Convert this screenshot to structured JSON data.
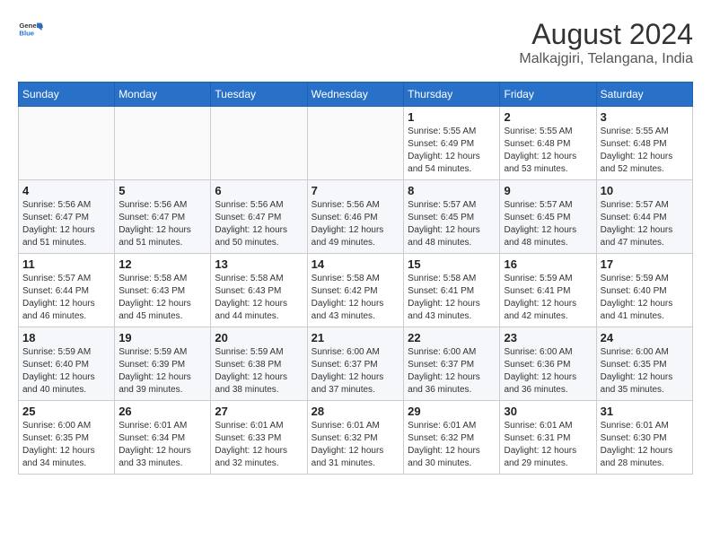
{
  "header": {
    "logo_general": "General",
    "logo_blue": "Blue",
    "title": "August 2024",
    "subtitle": "Malkajgiri, Telangana, India"
  },
  "weekdays": [
    "Sunday",
    "Monday",
    "Tuesday",
    "Wednesday",
    "Thursday",
    "Friday",
    "Saturday"
  ],
  "weeks": [
    [
      {
        "day": "",
        "info": ""
      },
      {
        "day": "",
        "info": ""
      },
      {
        "day": "",
        "info": ""
      },
      {
        "day": "",
        "info": ""
      },
      {
        "day": "1",
        "info": "Sunrise: 5:55 AM\nSunset: 6:49 PM\nDaylight: 12 hours\nand 54 minutes."
      },
      {
        "day": "2",
        "info": "Sunrise: 5:55 AM\nSunset: 6:48 PM\nDaylight: 12 hours\nand 53 minutes."
      },
      {
        "day": "3",
        "info": "Sunrise: 5:55 AM\nSunset: 6:48 PM\nDaylight: 12 hours\nand 52 minutes."
      }
    ],
    [
      {
        "day": "4",
        "info": "Sunrise: 5:56 AM\nSunset: 6:47 PM\nDaylight: 12 hours\nand 51 minutes."
      },
      {
        "day": "5",
        "info": "Sunrise: 5:56 AM\nSunset: 6:47 PM\nDaylight: 12 hours\nand 51 minutes."
      },
      {
        "day": "6",
        "info": "Sunrise: 5:56 AM\nSunset: 6:47 PM\nDaylight: 12 hours\nand 50 minutes."
      },
      {
        "day": "7",
        "info": "Sunrise: 5:56 AM\nSunset: 6:46 PM\nDaylight: 12 hours\nand 49 minutes."
      },
      {
        "day": "8",
        "info": "Sunrise: 5:57 AM\nSunset: 6:45 PM\nDaylight: 12 hours\nand 48 minutes."
      },
      {
        "day": "9",
        "info": "Sunrise: 5:57 AM\nSunset: 6:45 PM\nDaylight: 12 hours\nand 48 minutes."
      },
      {
        "day": "10",
        "info": "Sunrise: 5:57 AM\nSunset: 6:44 PM\nDaylight: 12 hours\nand 47 minutes."
      }
    ],
    [
      {
        "day": "11",
        "info": "Sunrise: 5:57 AM\nSunset: 6:44 PM\nDaylight: 12 hours\nand 46 minutes."
      },
      {
        "day": "12",
        "info": "Sunrise: 5:58 AM\nSunset: 6:43 PM\nDaylight: 12 hours\nand 45 minutes."
      },
      {
        "day": "13",
        "info": "Sunrise: 5:58 AM\nSunset: 6:43 PM\nDaylight: 12 hours\nand 44 minutes."
      },
      {
        "day": "14",
        "info": "Sunrise: 5:58 AM\nSunset: 6:42 PM\nDaylight: 12 hours\nand 43 minutes."
      },
      {
        "day": "15",
        "info": "Sunrise: 5:58 AM\nSunset: 6:41 PM\nDaylight: 12 hours\nand 43 minutes."
      },
      {
        "day": "16",
        "info": "Sunrise: 5:59 AM\nSunset: 6:41 PM\nDaylight: 12 hours\nand 42 minutes."
      },
      {
        "day": "17",
        "info": "Sunrise: 5:59 AM\nSunset: 6:40 PM\nDaylight: 12 hours\nand 41 minutes."
      }
    ],
    [
      {
        "day": "18",
        "info": "Sunrise: 5:59 AM\nSunset: 6:40 PM\nDaylight: 12 hours\nand 40 minutes."
      },
      {
        "day": "19",
        "info": "Sunrise: 5:59 AM\nSunset: 6:39 PM\nDaylight: 12 hours\nand 39 minutes."
      },
      {
        "day": "20",
        "info": "Sunrise: 5:59 AM\nSunset: 6:38 PM\nDaylight: 12 hours\nand 38 minutes."
      },
      {
        "day": "21",
        "info": "Sunrise: 6:00 AM\nSunset: 6:37 PM\nDaylight: 12 hours\nand 37 minutes."
      },
      {
        "day": "22",
        "info": "Sunrise: 6:00 AM\nSunset: 6:37 PM\nDaylight: 12 hours\nand 36 minutes."
      },
      {
        "day": "23",
        "info": "Sunrise: 6:00 AM\nSunset: 6:36 PM\nDaylight: 12 hours\nand 36 minutes."
      },
      {
        "day": "24",
        "info": "Sunrise: 6:00 AM\nSunset: 6:35 PM\nDaylight: 12 hours\nand 35 minutes."
      }
    ],
    [
      {
        "day": "25",
        "info": "Sunrise: 6:00 AM\nSunset: 6:35 PM\nDaylight: 12 hours\nand 34 minutes."
      },
      {
        "day": "26",
        "info": "Sunrise: 6:01 AM\nSunset: 6:34 PM\nDaylight: 12 hours\nand 33 minutes."
      },
      {
        "day": "27",
        "info": "Sunrise: 6:01 AM\nSunset: 6:33 PM\nDaylight: 12 hours\nand 32 minutes."
      },
      {
        "day": "28",
        "info": "Sunrise: 6:01 AM\nSunset: 6:32 PM\nDaylight: 12 hours\nand 31 minutes."
      },
      {
        "day": "29",
        "info": "Sunrise: 6:01 AM\nSunset: 6:32 PM\nDaylight: 12 hours\nand 30 minutes."
      },
      {
        "day": "30",
        "info": "Sunrise: 6:01 AM\nSunset: 6:31 PM\nDaylight: 12 hours\nand 29 minutes."
      },
      {
        "day": "31",
        "info": "Sunrise: 6:01 AM\nSunset: 6:30 PM\nDaylight: 12 hours\nand 28 minutes."
      }
    ]
  ]
}
